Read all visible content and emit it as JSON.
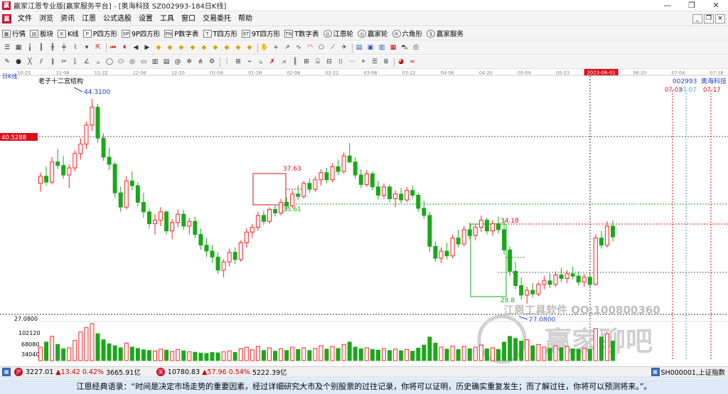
{
  "window": {
    "title": "赢家江恩专业版[赢家服务平台] - [奥海科技  SZ002993-184日K线]",
    "controls": [
      "—",
      "❐",
      "✕"
    ]
  },
  "menu": {
    "items": [
      "文件",
      "浏览",
      "资讯",
      "江恩",
      "公式选股",
      "设置",
      "工具",
      "窗口",
      "交易委托",
      "帮助"
    ],
    "mdi_controls": [
      "_",
      "❐",
      "×"
    ]
  },
  "toolbar1": {
    "items": [
      {
        "icon": "▦",
        "label": "行情"
      },
      {
        "icon": "▤",
        "label": "板块"
      },
      {
        "icon": "K",
        "label": "K线"
      },
      {
        "icon": "P",
        "label": "P四方形"
      },
      {
        "icon": "9P",
        "label": "9P四方形"
      },
      {
        "icon": "PN",
        "label": "P数字表"
      },
      {
        "icon": "T",
        "label": "T四方形"
      },
      {
        "icon": "9T",
        "label": "9T四方形"
      },
      {
        "icon": "TN",
        "label": "T数字表"
      },
      {
        "icon": "◎",
        "label": "江恩轮"
      },
      {
        "icon": "◎",
        "label": "赢家轮"
      },
      {
        "icon": "✡",
        "label": "六角形"
      },
      {
        "icon": "$",
        "label": "赢家服务"
      }
    ]
  },
  "chart_data": {
    "type": "candlestick",
    "panel_label": "日K线",
    "stock_code": "002993",
    "stock_name": "奥海科技",
    "indicator_label": "老子十二宫结构",
    "date_axis": [
      "10-25",
      "11-08",
      "11-22",
      "12-06",
      "12-20",
      "01-04",
      "01-18",
      "02-08",
      "02-22",
      "03-08",
      "03-22",
      "04-06",
      "04-20",
      "05-09",
      "05-23",
      "2023-06-01",
      "06-20",
      "07-04",
      "07-18"
    ],
    "right_panel": {
      "dates": [
        "07-03",
        "07-07",
        "07-17"
      ]
    },
    "price_axis_label": "40.5288",
    "volume_axis": [
      "102120",
      "68080",
      "34040"
    ],
    "price_low_marker": "27.0800",
    "price_annotations": [
      "44.3100",
      "37.63",
      "35.61",
      "34.18",
      "28.8",
      "27.0800"
    ],
    "candles_ohlc": [
      [
        37.2,
        38.1,
        36.5,
        37.8
      ],
      [
        37.8,
        38.6,
        37.0,
        37.3
      ],
      [
        37.3,
        39.4,
        37.1,
        39.0
      ],
      [
        39.0,
        40.1,
        38.4,
        38.7
      ],
      [
        38.7,
        39.5,
        37.6,
        37.9
      ],
      [
        37.9,
        38.8,
        36.8,
        38.5
      ],
      [
        38.5,
        40.0,
        38.2,
        39.7
      ],
      [
        39.7,
        41.0,
        39.2,
        40.5
      ],
      [
        40.5,
        42.4,
        40.1,
        42.1
      ],
      [
        42.1,
        44.3,
        41.6,
        43.6
      ],
      [
        43.6,
        43.9,
        40.6,
        41.0
      ],
      [
        41.0,
        41.4,
        39.1,
        39.4
      ],
      [
        39.4,
        40.2,
        38.3,
        38.8
      ],
      [
        38.8,
        39.0,
        36.0,
        36.4
      ],
      [
        36.4,
        36.9,
        34.8,
        35.2
      ],
      [
        35.2,
        37.8,
        35.0,
        37.4
      ],
      [
        37.4,
        38.2,
        36.6,
        37.0
      ],
      [
        37.0,
        37.3,
        35.3,
        35.6
      ],
      [
        35.6,
        36.4,
        34.3,
        34.8
      ],
      [
        34.8,
        35.1,
        33.4,
        33.8
      ],
      [
        33.8,
        34.6,
        32.9,
        34.1
      ],
      [
        34.1,
        35.2,
        33.6,
        34.8
      ],
      [
        34.8,
        34.9,
        32.9,
        33.2
      ],
      [
        33.2,
        34.2,
        32.5,
        33.9
      ],
      [
        33.9,
        35.0,
        33.5,
        34.6
      ],
      [
        34.6,
        35.0,
        33.3,
        33.6
      ],
      [
        33.6,
        34.3,
        32.9,
        34.0
      ],
      [
        34.0,
        34.4,
        32.6,
        32.9
      ],
      [
        32.9,
        33.4,
        31.6,
        32.0
      ],
      [
        32.0,
        32.6,
        31.0,
        31.5
      ],
      [
        31.5,
        32.0,
        30.5,
        31.0
      ],
      [
        31.0,
        31.4,
        29.6,
        29.9
      ],
      [
        29.9,
        30.8,
        29.3,
        30.6
      ],
      [
        30.6,
        31.7,
        30.2,
        31.4
      ],
      [
        31.4,
        31.8,
        30.4,
        30.8
      ],
      [
        30.8,
        32.4,
        30.6,
        32.2
      ],
      [
        32.2,
        33.4,
        31.8,
        33.1
      ],
      [
        33.1,
        33.8,
        32.6,
        33.5
      ],
      [
        33.5,
        34.8,
        33.2,
        34.5
      ],
      [
        34.5,
        34.9,
        33.7,
        34.0
      ],
      [
        34.0,
        35.2,
        33.8,
        35.0
      ],
      [
        35.0,
        35.4,
        34.4,
        34.7
      ],
      [
        34.7,
        35.9,
        34.5,
        35.6
      ],
      [
        35.6,
        36.0,
        34.9,
        35.3
      ],
      [
        35.3,
        36.6,
        35.1,
        36.3
      ],
      [
        36.3,
        37.0,
        35.8,
        36.1
      ],
      [
        36.1,
        37.4,
        35.9,
        37.2
      ],
      [
        37.2,
        37.6,
        36.4,
        36.7
      ],
      [
        36.7,
        37.8,
        36.5,
        37.5
      ],
      [
        37.5,
        38.4,
        37.0,
        38.1
      ],
      [
        38.1,
        38.5,
        37.2,
        37.5
      ],
      [
        37.5,
        38.9,
        37.3,
        38.6
      ],
      [
        38.6,
        39.2,
        37.9,
        38.2
      ],
      [
        38.2,
        39.8,
        38.0,
        39.5
      ],
      [
        39.5,
        40.6,
        38.9,
        39.0
      ],
      [
        39.0,
        39.4,
        37.6,
        37.9
      ],
      [
        37.9,
        38.4,
        36.8,
        37.1
      ],
      [
        37.1,
        38.3,
        36.9,
        38.0
      ],
      [
        38.0,
        38.2,
        36.6,
        36.9
      ],
      [
        36.9,
        37.4,
        35.8,
        36.2
      ],
      [
        36.2,
        37.2,
        35.9,
        36.9
      ],
      [
        36.9,
        37.1,
        35.6,
        35.9
      ],
      [
        35.9,
        36.6,
        35.2,
        36.3
      ],
      [
        36.3,
        36.8,
        35.5,
        35.8
      ],
      [
        35.8,
        36.9,
        35.6,
        36.6
      ],
      [
        36.6,
        37.0,
        35.9,
        36.2
      ],
      [
        36.2,
        36.4,
        34.8,
        35.1
      ],
      [
        35.1,
        35.7,
        34.2,
        34.5
      ],
      [
        34.5,
        34.8,
        31.4,
        31.9
      ],
      [
        31.9,
        32.3,
        30.6,
        30.9
      ],
      [
        30.9,
        31.8,
        30.5,
        31.5
      ],
      [
        31.5,
        32.2,
        30.8,
        31.1
      ],
      [
        31.1,
        32.9,
        30.9,
        32.6
      ],
      [
        32.6,
        33.3,
        31.8,
        32.1
      ],
      [
        32.1,
        33.6,
        31.9,
        33.3
      ],
      [
        33.3,
        33.9,
        32.5,
        32.8
      ],
      [
        32.8,
        33.8,
        32.4,
        33.5
      ],
      [
        33.5,
        34.5,
        33.1,
        34.1
      ],
      [
        34.1,
        34.3,
        32.9,
        33.2
      ],
      [
        33.2,
        34.1,
        32.8,
        33.8
      ],
      [
        33.8,
        34.4,
        33.0,
        33.3
      ],
      [
        33.3,
        34.0,
        31.2,
        31.6
      ],
      [
        31.6,
        31.9,
        29.4,
        29.8
      ],
      [
        29.8,
        30.6,
        28.3,
        28.6
      ],
      [
        28.6,
        29.3,
        27.4,
        27.8
      ],
      [
        27.8,
        28.5,
        27.08,
        28.2
      ],
      [
        28.2,
        28.8,
        27.6,
        27.9
      ],
      [
        27.9,
        28.9,
        27.7,
        28.7
      ],
      [
        28.7,
        29.4,
        28.3,
        29.0
      ],
      [
        29.0,
        29.6,
        28.4,
        28.7
      ],
      [
        28.7,
        29.8,
        28.5,
        29.5
      ],
      [
        29.5,
        30.1,
        28.9,
        29.2
      ],
      [
        29.2,
        29.9,
        28.8,
        29.6
      ],
      [
        29.6,
        30.2,
        29.1,
        29.4
      ],
      [
        29.4,
        29.8,
        28.6,
        28.9
      ],
      [
        28.9,
        29.6,
        28.5,
        29.3
      ],
      [
        29.3,
        29.7,
        28.4,
        28.7
      ],
      [
        28.7,
        32.9,
        28.6,
        32.6
      ],
      [
        32.6,
        33.2,
        31.7,
        32.0
      ],
      [
        32.0,
        34.0,
        31.8,
        33.6
      ],
      [
        33.6,
        34.1,
        32.3,
        32.7
      ]
    ],
    "volumes": [
      40,
      55,
      72,
      48,
      35,
      38,
      60,
      85,
      98,
      110,
      80,
      62,
      50,
      44,
      38,
      52,
      40,
      36,
      32,
      30,
      28,
      34,
      31,
      27,
      33,
      29,
      26,
      25,
      22,
      21,
      24,
      23,
      26,
      29,
      24,
      35,
      40,
      32,
      42,
      30,
      38,
      28,
      35,
      30,
      40,
      33,
      38,
      30,
      36,
      44,
      34,
      42,
      36,
      48,
      55,
      40,
      35,
      38,
      33,
      31,
      35,
      30,
      34,
      29,
      33,
      28,
      37,
      46,
      70,
      52,
      40,
      34,
      43,
      33,
      42,
      35,
      40,
      46,
      35,
      38,
      33,
      55,
      72,
      66,
      58,
      62,
      44,
      48,
      40,
      36,
      44,
      38,
      42,
      35,
      33,
      37,
      34,
      95,
      70,
      80,
      58
    ]
  },
  "statusbar": {
    "sh_value": "3227.01",
    "sh_change": "▲13.42",
    "sh_pct": "0.42%",
    "sh_amount": "3665.91亿",
    "sz_value": "10780.83",
    "sz_change": "▲57.96",
    "sz_pct": "0.54%",
    "sz_amount": "5222.39亿",
    "right_label": "SH000001,上证指数"
  },
  "quote": {
    "text": "江恩经典语录：“时间是决定市场走势的重要因素，经过详细研究大市及个别股票的过往记录，你将可以证明，历史确实重复发生；而了解过往，你将可以预测将来。”。"
  },
  "watermark": {
    "line1": "江恩工具软件  QQ:100800360",
    "line2": "赢家聊吧"
  },
  "colors": {
    "up": "#ff2020",
    "down": "#1aa81a",
    "accent_red": "#d8101a",
    "grid": "#b0b0b0"
  }
}
